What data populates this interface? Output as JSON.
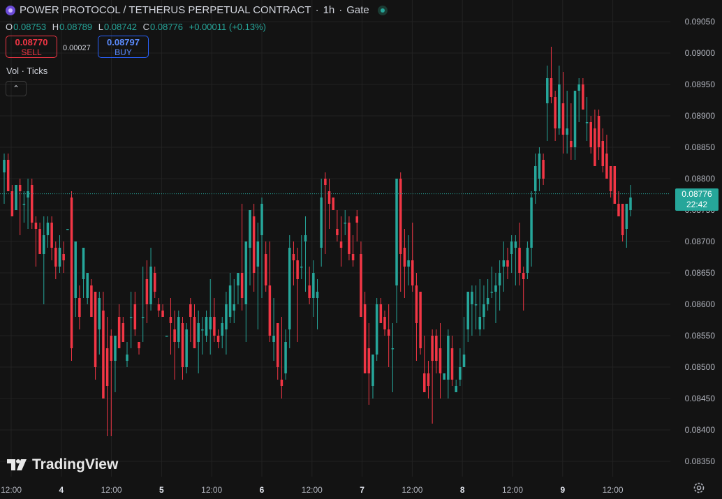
{
  "header": {
    "symbol": "POWER PROTOCOL / TETHERUS PERPETUAL CONTRACT",
    "interval": "1h",
    "exchange": "Gate",
    "open_label": "O",
    "open": "0.08753",
    "high_label": "H",
    "high": "0.08789",
    "low_label": "L",
    "low": "0.08742",
    "close_label": "C",
    "close": "0.08776",
    "change": "+0.00011 (+0.13%)"
  },
  "trade": {
    "sell_price": "0.08770",
    "sell_label": "SELL",
    "spread": "0.00027",
    "buy_price": "0.08797",
    "buy_label": "BUY"
  },
  "indicator": {
    "label": "Vol · Ticks",
    "collapse_icon": "chevron-up-icon"
  },
  "last_price": {
    "price": "0.08776",
    "countdown": "22:42"
  },
  "branding": {
    "name": "TradingView"
  },
  "colors": {
    "background": "#131313",
    "up": "#26a69a",
    "down": "#f23645",
    "grid": "#222222",
    "text": "#d1d4dc"
  },
  "chart_data": {
    "type": "candlestick",
    "x_tick_labels": [
      "12:00",
      "4",
      "12:00",
      "5",
      "12:00",
      "6",
      "12:00",
      "7",
      "12:00",
      "8",
      "12:00",
      "9",
      "12:00"
    ],
    "y_tick_labels": [
      "0.09050",
      "0.09000",
      "0.08950",
      "0.08900",
      "0.08850",
      "0.08800",
      "0.08750",
      "0.08700",
      "0.08650",
      "0.08600",
      "0.08550",
      "0.08500",
      "0.08450",
      "0.08400",
      "0.08350"
    ],
    "ylim": [
      0.0832,
      0.0908
    ],
    "last_price": 0.08776,
    "grid": true,
    "ohlc": [
      [
        0.0881,
        0.0884,
        0.0876,
        0.0883
      ],
      [
        0.0883,
        0.0884,
        0.0878,
        0.0878
      ],
      [
        0.0878,
        0.0879,
        0.0874,
        0.0874
      ],
      [
        0.0875,
        0.0879,
        0.0875,
        0.0879
      ],
      [
        0.0879,
        0.088,
        0.0871,
        0.0878
      ],
      [
        0.0876,
        0.0878,
        0.0873,
        0.0876
      ],
      [
        0.0877,
        0.088,
        0.0872,
        0.0878
      ],
      [
        0.0879,
        0.088,
        0.0872,
        0.0873
      ],
      [
        0.0873,
        0.0874,
        0.0866,
        0.0872
      ],
      [
        0.0872,
        0.0873,
        0.0868,
        0.0868
      ],
      [
        0.0868,
        0.0874,
        0.086,
        0.0871
      ],
      [
        0.0871,
        0.0874,
        0.0869,
        0.0873
      ],
      [
        0.0873,
        0.0874,
        0.0867,
        0.0869
      ],
      [
        0.0869,
        0.087,
        0.0864,
        0.0866
      ],
      [
        0.0866,
        0.0871,
        0.0865,
        0.0869
      ],
      [
        0.0868,
        0.087,
        0.0865,
        0.0867
      ],
      [
        0.0872,
        0.0872,
        0.0872,
        0.0872
      ],
      [
        0.0877,
        0.0878,
        0.0851,
        0.0853
      ],
      [
        0.0861,
        0.087,
        0.0858,
        0.087
      ],
      [
        0.0861,
        0.0863,
        0.0856,
        0.0858
      ],
      [
        0.0864,
        0.0869,
        0.0861,
        0.0869
      ],
      [
        0.0861,
        0.0865,
        0.086,
        0.0865
      ],
      [
        0.0863,
        0.0864,
        0.0858,
        0.0858
      ],
      [
        0.0862,
        0.0862,
        0.0848,
        0.085
      ],
      [
        0.0856,
        0.0862,
        0.0852,
        0.0861
      ],
      [
        0.0859,
        0.0862,
        0.0845,
        0.0845
      ],
      [
        0.0853,
        0.0858,
        0.0839,
        0.0847
      ],
      [
        0.0855,
        0.0856,
        0.0839,
        0.0851
      ],
      [
        0.0851,
        0.0855,
        0.0846,
        0.0855
      ],
      [
        0.0858,
        0.086,
        0.0853,
        0.0853
      ],
      [
        0.0857,
        0.0858,
        0.0854,
        0.0854
      ],
      [
        0.0851,
        0.0854,
        0.085,
        0.0852
      ],
      [
        0.0858,
        0.0862,
        0.0853,
        0.0858
      ],
      [
        0.086,
        0.0862,
        0.0855,
        0.0856
      ],
      [
        0.0854,
        0.0854,
        0.0852,
        0.0853
      ],
      [
        0.0858,
        0.0866,
        0.0854,
        0.0858
      ],
      [
        0.0864,
        0.0867,
        0.0857,
        0.086
      ],
      [
        0.086,
        0.0869,
        0.0859,
        0.0866
      ],
      [
        0.0865,
        0.0866,
        0.0861,
        0.0862
      ],
      [
        0.086,
        0.0861,
        0.0858,
        0.0859
      ],
      [
        0.0859,
        0.086,
        0.0858,
        0.0858
      ],
      [
        0.0855,
        0.0855,
        0.0855,
        0.0855
      ],
      [
        0.0858,
        0.0861,
        0.0852,
        0.0857
      ],
      [
        0.0856,
        0.0859,
        0.0848,
        0.0854
      ],
      [
        0.0854,
        0.0859,
        0.0853,
        0.0858
      ],
      [
        0.0857,
        0.0858,
        0.0848,
        0.085
      ],
      [
        0.085,
        0.0857,
        0.0849,
        0.0856
      ],
      [
        0.086,
        0.0861,
        0.0854,
        0.0858
      ],
      [
        0.0858,
        0.086,
        0.0853,
        0.0853
      ],
      [
        0.0854,
        0.0859,
        0.0849,
        0.0857
      ],
      [
        0.0856,
        0.0858,
        0.0852,
        0.0856
      ],
      [
        0.0855,
        0.0859,
        0.0854,
        0.0858
      ],
      [
        0.0856,
        0.0864,
        0.0852,
        0.0858
      ],
      [
        0.0858,
        0.0861,
        0.0854,
        0.0855
      ],
      [
        0.0855,
        0.0856,
        0.0853,
        0.0854
      ],
      [
        0.0855,
        0.0858,
        0.0853,
        0.0857
      ],
      [
        0.0856,
        0.0862,
        0.0852,
        0.086
      ],
      [
        0.0858,
        0.0865,
        0.0857,
        0.0863
      ],
      [
        0.0859,
        0.0864,
        0.0857,
        0.086
      ],
      [
        0.0863,
        0.0865,
        0.086,
        0.0865
      ],
      [
        0.0865,
        0.0876,
        0.0859,
        0.0861
      ],
      [
        0.086,
        0.0868,
        0.0854,
        0.087
      ],
      [
        0.0869,
        0.0875,
        0.0863,
        0.0875
      ],
      [
        0.0874,
        0.0876,
        0.0862,
        0.0865
      ],
      [
        0.0866,
        0.0873,
        0.0856,
        0.087
      ],
      [
        0.0871,
        0.0877,
        0.0861,
        0.0876
      ],
      [
        0.0868,
        0.087,
        0.0862,
        0.0863
      ],
      [
        0.0863,
        0.087,
        0.0854,
        0.0855
      ],
      [
        0.0854,
        0.0861,
        0.0851,
        0.0855
      ],
      [
        0.0857,
        0.0857,
        0.0848,
        0.085
      ],
      [
        0.0848,
        0.0858,
        0.0845,
        0.0847
      ],
      [
        0.0849,
        0.0856,
        0.0848,
        0.0854
      ],
      [
        0.0856,
        0.0871,
        0.0853,
        0.0869
      ],
      [
        0.0868,
        0.087,
        0.0863,
        0.0867
      ],
      [
        0.0867,
        0.0869,
        0.0854,
        0.0864
      ],
      [
        0.0866,
        0.0871,
        0.0864,
        0.0866
      ],
      [
        0.087,
        0.0874,
        0.0862,
        0.0871
      ],
      [
        0.0863,
        0.0866,
        0.086,
        0.0861
      ],
      [
        0.0861,
        0.0867,
        0.0858,
        0.0865
      ],
      [
        0.0861,
        0.0864,
        0.0856,
        0.0862
      ],
      [
        0.0869,
        0.088,
        0.0866,
        0.0877
      ],
      [
        0.088,
        0.0881,
        0.0868,
        0.0879
      ],
      [
        0.0878,
        0.088,
        0.0872,
        0.0876
      ],
      [
        0.0877,
        0.0877,
        0.0875,
        0.0875
      ],
      [
        0.0872,
        0.0875,
        0.087,
        0.0871
      ],
      [
        0.087,
        0.0874,
        0.0866,
        0.0869
      ],
      [
        0.0873,
        0.0875,
        0.0871,
        0.0873
      ],
      [
        0.0873,
        0.0874,
        0.0867,
        0.0868
      ],
      [
        0.0868,
        0.0871,
        0.0866,
        0.0867
      ],
      [
        0.0874,
        0.0875,
        0.087,
        0.0873
      ],
      [
        0.0868,
        0.087,
        0.0858,
        0.0858
      ],
      [
        0.086,
        0.0862,
        0.0849,
        0.0849
      ],
      [
        0.0853,
        0.0857,
        0.0844,
        0.0849
      ],
      [
        0.0847,
        0.0852,
        0.0845,
        0.0852
      ],
      [
        0.0852,
        0.0861,
        0.0851,
        0.086
      ],
      [
        0.086,
        0.0861,
        0.0857,
        0.0857
      ],
      [
        0.0858,
        0.0859,
        0.0855,
        0.0856
      ],
      [
        0.0856,
        0.086,
        0.085,
        0.0855
      ],
      [
        0.0853,
        0.0857,
        0.0846,
        0.0853
      ],
      [
        0.0863,
        0.0876,
        0.0857,
        0.088
      ],
      [
        0.088,
        0.0881,
        0.0862,
        0.0868
      ],
      [
        0.0869,
        0.0872,
        0.0861,
        0.0866
      ],
      [
        0.0866,
        0.0871,
        0.0863,
        0.0867
      ],
      [
        0.0867,
        0.0873,
        0.0862,
        0.0863
      ],
      [
        0.0863,
        0.0865,
        0.0851,
        0.0857
      ],
      [
        0.0862,
        0.0862,
        0.0852,
        0.0853
      ],
      [
        0.0849,
        0.0855,
        0.0846,
        0.0846
      ],
      [
        0.0849,
        0.0851,
        0.0845,
        0.0847
      ],
      [
        0.0855,
        0.0856,
        0.0841,
        0.0851
      ],
      [
        0.0855,
        0.0856,
        0.0849,
        0.0851
      ],
      [
        0.0853,
        0.0857,
        0.0845,
        0.0849
      ],
      [
        0.0848,
        0.0849,
        0.0848,
        0.0849
      ],
      [
        0.0848,
        0.0856,
        0.0845,
        0.0855
      ],
      [
        0.0853,
        0.0855,
        0.0847,
        0.0848
      ],
      [
        0.0846,
        0.0848,
        0.0846,
        0.0847
      ],
      [
        0.0848,
        0.0853,
        0.0847,
        0.085
      ],
      [
        0.085,
        0.0858,
        0.085,
        0.0852
      ],
      [
        0.0856,
        0.0861,
        0.0854,
        0.0862
      ],
      [
        0.086,
        0.0863,
        0.0855,
        0.0862
      ],
      [
        0.086,
        0.0863,
        0.0856,
        0.086
      ],
      [
        0.0856,
        0.0864,
        0.0855,
        0.0858
      ],
      [
        0.0858,
        0.0863,
        0.0856,
        0.086
      ],
      [
        0.086,
        0.0864,
        0.0859,
        0.0861
      ],
      [
        0.0862,
        0.0866,
        0.0861,
        0.0862
      ],
      [
        0.0862,
        0.0865,
        0.0857,
        0.0863
      ],
      [
        0.0863,
        0.0867,
        0.0859,
        0.0865
      ],
      [
        0.0866,
        0.087,
        0.0862,
        0.0867
      ],
      [
        0.0867,
        0.0869,
        0.0864,
        0.0866
      ],
      [
        0.0868,
        0.0871,
        0.0865,
        0.087
      ],
      [
        0.0869,
        0.0871,
        0.0863,
        0.087
      ],
      [
        0.0869,
        0.0873,
        0.0863,
        0.0865
      ],
      [
        0.0865,
        0.0866,
        0.0859,
        0.0864
      ],
      [
        0.0865,
        0.087,
        0.0864,
        0.0869
      ],
      [
        0.0869,
        0.0878,
        0.0866,
        0.0877
      ],
      [
        0.0878,
        0.0884,
        0.0876,
        0.0882
      ],
      [
        0.088,
        0.0885,
        0.0878,
        0.0884
      ],
      [
        0.0883,
        0.0884,
        0.0879,
        0.088
      ],
      [
        0.0892,
        0.0898,
        0.0886,
        0.0896
      ],
      [
        0.0896,
        0.0901,
        0.0892,
        0.0893
      ],
      [
        0.0893,
        0.0894,
        0.0886,
        0.0888
      ],
      [
        0.0888,
        0.0898,
        0.0887,
        0.0895
      ],
      [
        0.0892,
        0.0897,
        0.0884,
        0.0887
      ],
      [
        0.0887,
        0.0894,
        0.0884,
        0.0888
      ],
      [
        0.0886,
        0.0892,
        0.0883,
        0.0885
      ],
      [
        0.0885,
        0.0894,
        0.0883,
        0.0894
      ],
      [
        0.0894,
        0.0896,
        0.0889,
        0.0895
      ],
      [
        0.0895,
        0.0896,
        0.0891,
        0.0891
      ],
      [
        0.0889,
        0.0893,
        0.0886,
        0.0889
      ],
      [
        0.0889,
        0.089,
        0.0884,
        0.0885
      ],
      [
        0.0888,
        0.0891,
        0.0883,
        0.0882
      ],
      [
        0.089,
        0.0891,
        0.0883,
        0.0885
      ],
      [
        0.0886,
        0.0888,
        0.0881,
        0.0882
      ],
      [
        0.0884,
        0.0887,
        0.0882,
        0.088
      ],
      [
        0.0882,
        0.0882,
        0.0877,
        0.0878
      ],
      [
        0.0882,
        0.0882,
        0.0876,
        0.0876
      ],
      [
        0.0876,
        0.0878,
        0.0874,
        0.0874
      ],
      [
        0.0876,
        0.0876,
        0.087,
        0.0871
      ],
      [
        0.0872,
        0.0876,
        0.0869,
        0.0876
      ],
      [
        0.0875,
        0.0879,
        0.0874,
        0.0877
      ]
    ]
  }
}
